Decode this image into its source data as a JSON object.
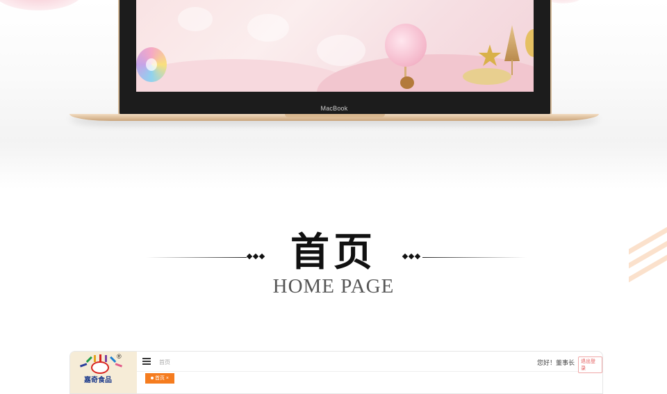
{
  "mockup": {
    "laptop_brand": "MacBook"
  },
  "section": {
    "title": "首页",
    "subtitle": "HOME PAGE"
  },
  "app": {
    "logo_mark": "®",
    "logo_text": "嘉奇食品",
    "breadcrumb_home": "首页",
    "greeting": "您好！董事长",
    "logout_label": "退出登录",
    "active_tab_label": "首页",
    "active_tab_close": "×"
  },
  "colors": {
    "accent_orange": "#f57c1f",
    "logout_red": "#e25555",
    "laptop_gold": "#d4b998",
    "stripe_peach": "#fbe1cc"
  },
  "icons": {
    "menu": "hamburger-icon",
    "tab_dot": "dot-icon",
    "deco": "diamond-icon"
  }
}
